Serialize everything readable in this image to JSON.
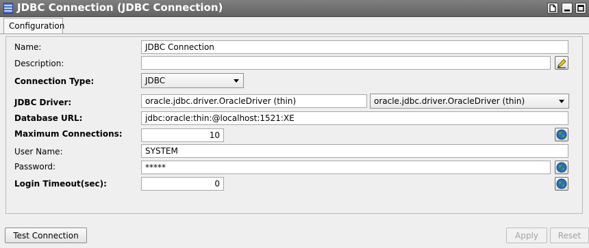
{
  "window": {
    "title": "JDBC Connection (JDBC Connection)"
  },
  "tabs": [
    {
      "label": "Configuration",
      "active": true
    }
  ],
  "form": {
    "name": {
      "label": "Name:",
      "value": "JDBC Connection"
    },
    "description": {
      "label": "Description:",
      "value": ""
    },
    "connection_type": {
      "label": "Connection Type:",
      "value": "JDBC"
    },
    "jdbc_driver": {
      "label": "JDBC Driver:",
      "value": "oracle.jdbc.driver.OracleDriver (thin)",
      "selected": "oracle.jdbc.driver.OracleDriver (thin)"
    },
    "database_url": {
      "label": "Database URL:",
      "value": "jdbc:oracle:thin:@localhost:1521:XE"
    },
    "max_connections": {
      "label": "Maximum Connections:",
      "value": "10"
    },
    "user_name": {
      "label": "User Name:",
      "value": "SYSTEM"
    },
    "password": {
      "label": "Password:",
      "value": "*****"
    },
    "login_timeout": {
      "label": "Login Timeout(sec):",
      "value": "0"
    }
  },
  "buttons": {
    "test_connection": "Test Connection",
    "apply": "Apply",
    "reset": "Reset"
  },
  "icons": {
    "window_icon": "database-table-icon",
    "edit": "pencil-icon",
    "globe": "globe-icon"
  },
  "colors": {
    "titlebar": "#6d6d6d",
    "panel": "#efefef"
  }
}
